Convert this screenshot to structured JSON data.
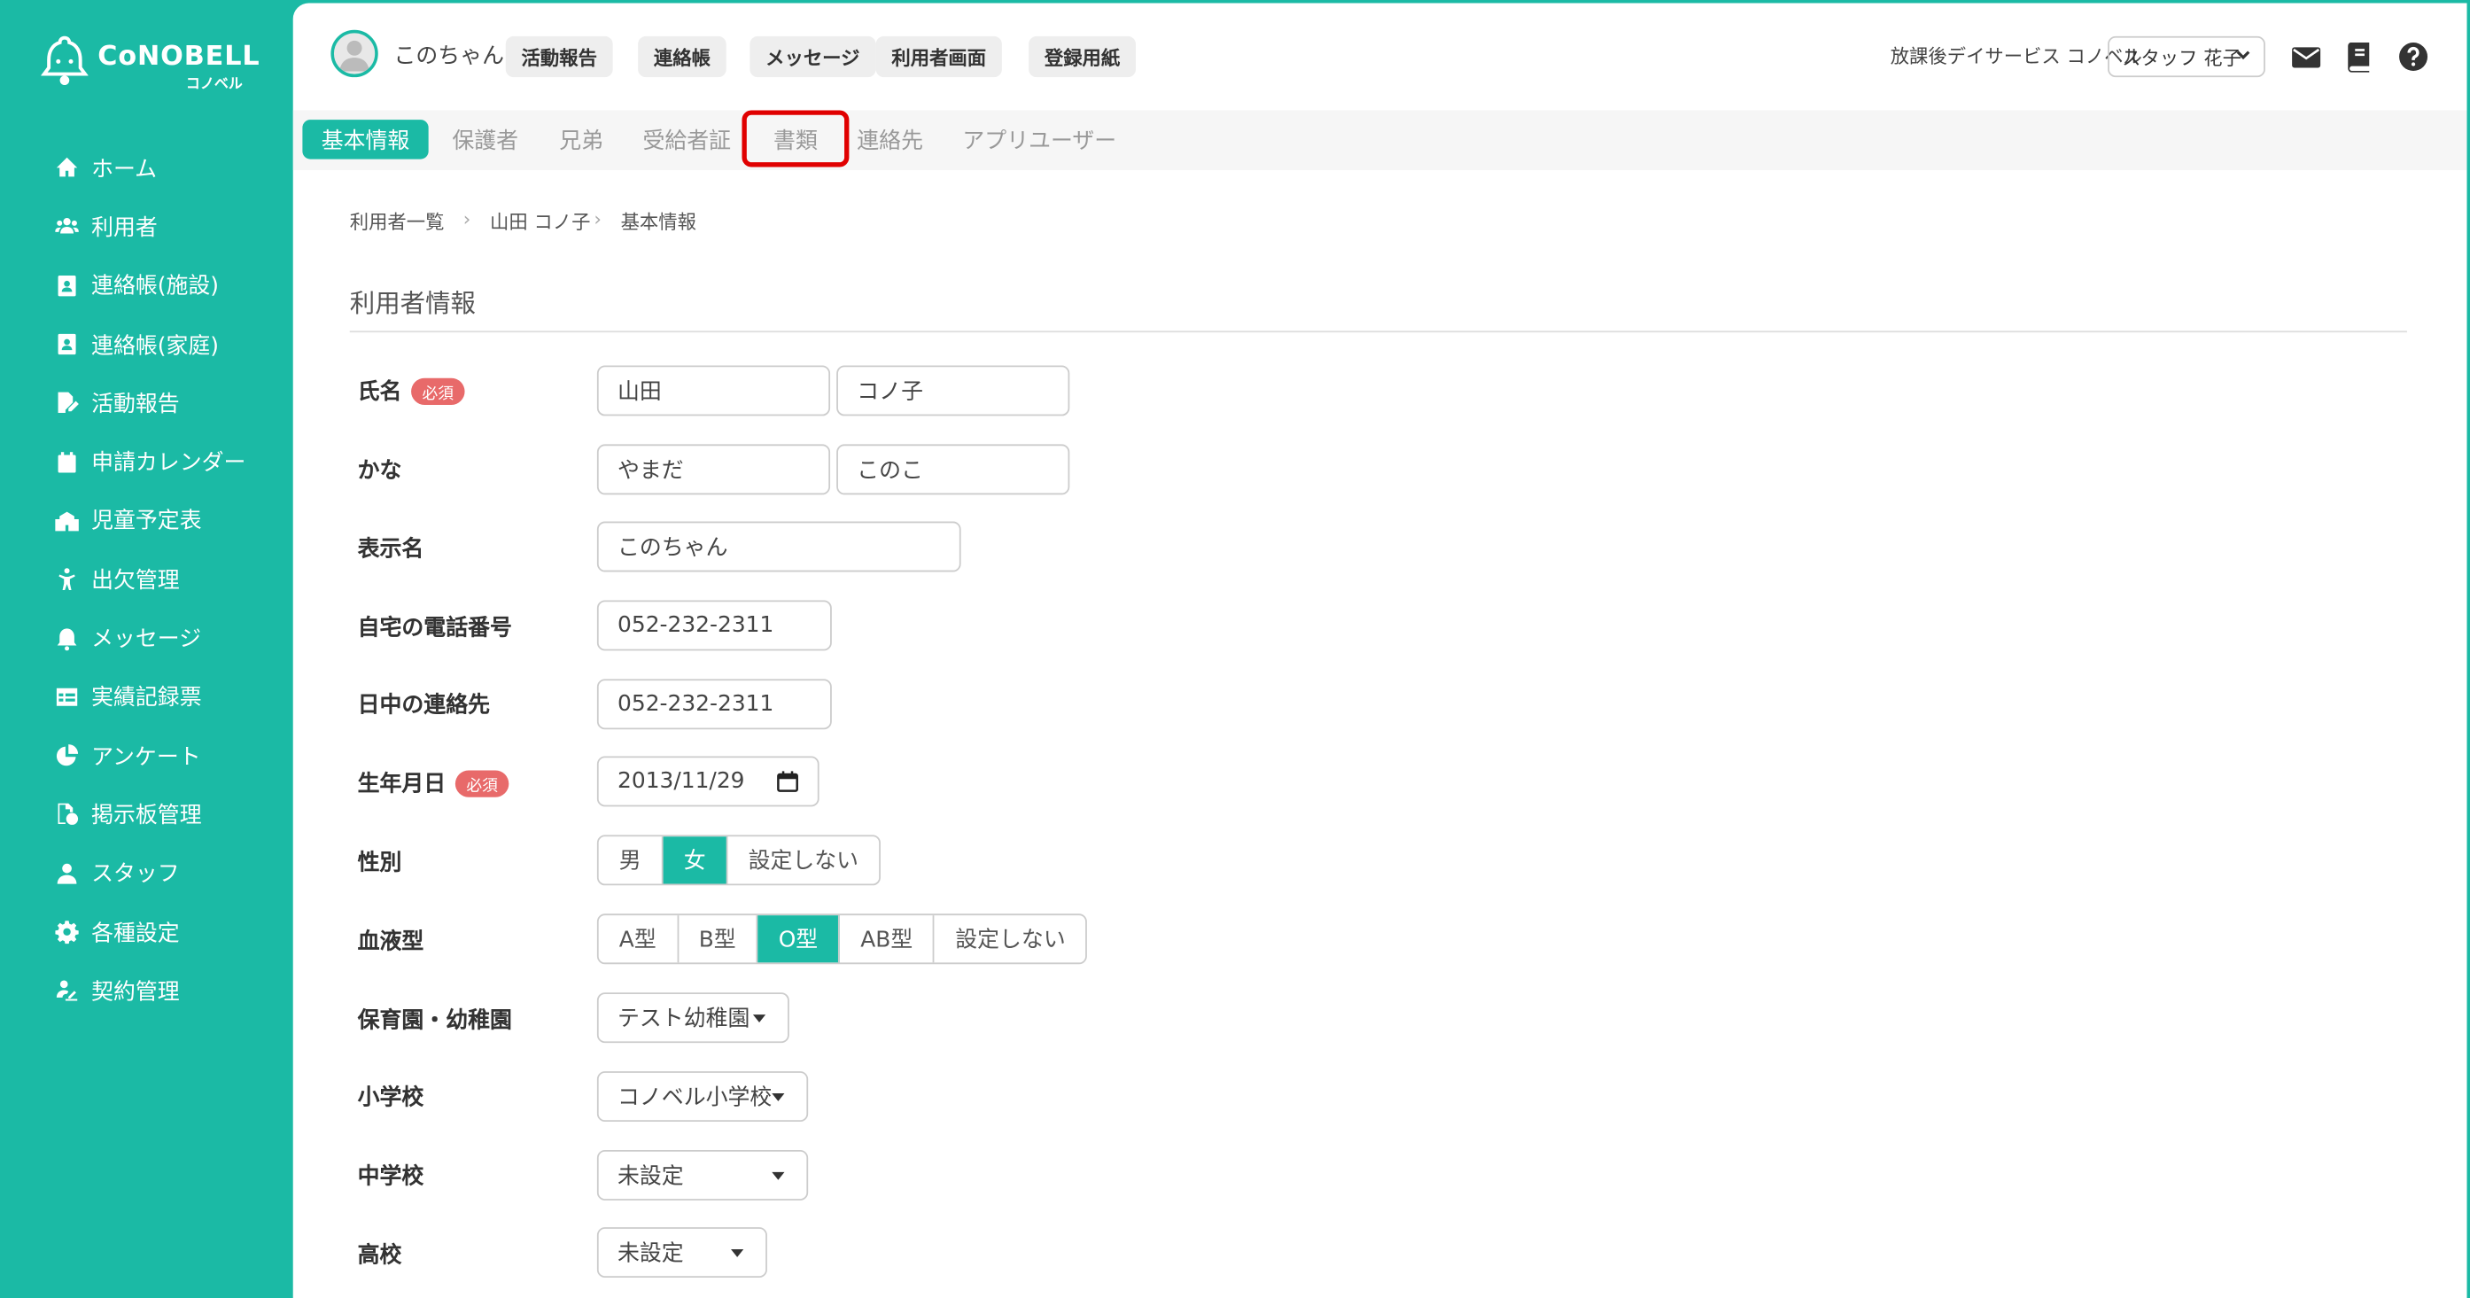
{
  "brand": {
    "name": "CoNOBELL",
    "kana": "コノベル"
  },
  "sidebar": {
    "items": [
      {
        "label": "ホーム",
        "icon": "home-icon"
      },
      {
        "label": "利用者",
        "icon": "users-icon"
      },
      {
        "label": "連絡帳(施設)",
        "icon": "contact-book-icon"
      },
      {
        "label": "連絡帳(家庭)",
        "icon": "contact-book-icon"
      },
      {
        "label": "活動報告",
        "icon": "report-edit-icon"
      },
      {
        "label": "申請カレンダー",
        "icon": "calendar-icon"
      },
      {
        "label": "児童予定表",
        "icon": "school-icon"
      },
      {
        "label": "出欠管理",
        "icon": "person-icon"
      },
      {
        "label": "メッセージ",
        "icon": "bell-icon"
      },
      {
        "label": "実績記録票",
        "icon": "table-icon"
      },
      {
        "label": "アンケート",
        "icon": "pie-chart-icon"
      },
      {
        "label": "掲示板管理",
        "icon": "board-icon"
      },
      {
        "label": "スタッフ",
        "icon": "staff-icon"
      },
      {
        "label": "各種設定",
        "icon": "gear-icon"
      },
      {
        "label": "契約管理",
        "icon": "contract-icon"
      }
    ]
  },
  "header": {
    "user_name": "このちゃん",
    "buttons": [
      "活動報告",
      "連絡帳",
      "メッセージ",
      "利用者画面",
      "登録用紙"
    ],
    "facility": "放課後デイサービス コノベル",
    "staff": "スタッフ 花子"
  },
  "tabs": [
    {
      "label": "基本情報",
      "active": true
    },
    {
      "label": "保護者",
      "active": false
    },
    {
      "label": "兄弟",
      "active": false
    },
    {
      "label": "受給者証",
      "active": false
    },
    {
      "label": "書類",
      "active": false,
      "highlighted": true
    },
    {
      "label": "連絡先",
      "active": false
    },
    {
      "label": "アプリユーザー",
      "active": false
    }
  ],
  "breadcrumb": [
    "利用者一覧",
    "山田 コノ子",
    "基本情報"
  ],
  "section_title": "利用者情報",
  "required_badge": "必須",
  "form": {
    "name": {
      "label": "氏名",
      "last": "山田",
      "first": "コノ子"
    },
    "kana": {
      "label": "かな",
      "last": "やまだ",
      "first": "このこ"
    },
    "display_name": {
      "label": "表示名",
      "value": "このちゃん"
    },
    "home_phone": {
      "label": "自宅の電話番号",
      "value": "052-232-2311"
    },
    "day_contact": {
      "label": "日中の連絡先",
      "value": "052-232-2311"
    },
    "birthday": {
      "label": "生年月日",
      "value": "2013/11/29"
    },
    "gender": {
      "label": "性別",
      "options": [
        "男",
        "女",
        "設定しない"
      ],
      "selected": "女"
    },
    "blood": {
      "label": "血液型",
      "options": [
        "A型",
        "B型",
        "O型",
        "AB型",
        "設定しない"
      ],
      "selected": "O型"
    },
    "nursery": {
      "label": "保育園・幼稚園",
      "value": "テスト幼稚園"
    },
    "elementary": {
      "label": "小学校",
      "value": "コノベル小学校"
    },
    "junior_high": {
      "label": "中学校",
      "value": "未設定"
    },
    "high_school": {
      "label": "高校",
      "value": "未設定"
    }
  },
  "colors": {
    "accent": "#1bbaa5",
    "highlight": "#e00000",
    "required": "#e86a6a"
  }
}
